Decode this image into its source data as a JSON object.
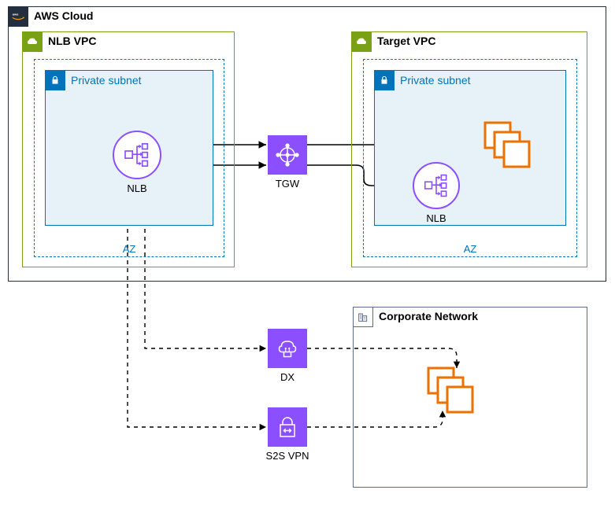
{
  "cloud": {
    "title": "AWS Cloud"
  },
  "vpc_left": {
    "title": "NLB VPC",
    "subnet": "Private subnet",
    "az": "AZ",
    "nlb": "NLB"
  },
  "vpc_right": {
    "title": "Target VPC",
    "subnet": "Private subnet",
    "az": "AZ",
    "nlb": "NLB"
  },
  "tgw": {
    "label": "TGW"
  },
  "dx": {
    "label": "DX"
  },
  "vpn": {
    "label": "S2S VPN"
  },
  "corp": {
    "title": "Corporate Network"
  }
}
